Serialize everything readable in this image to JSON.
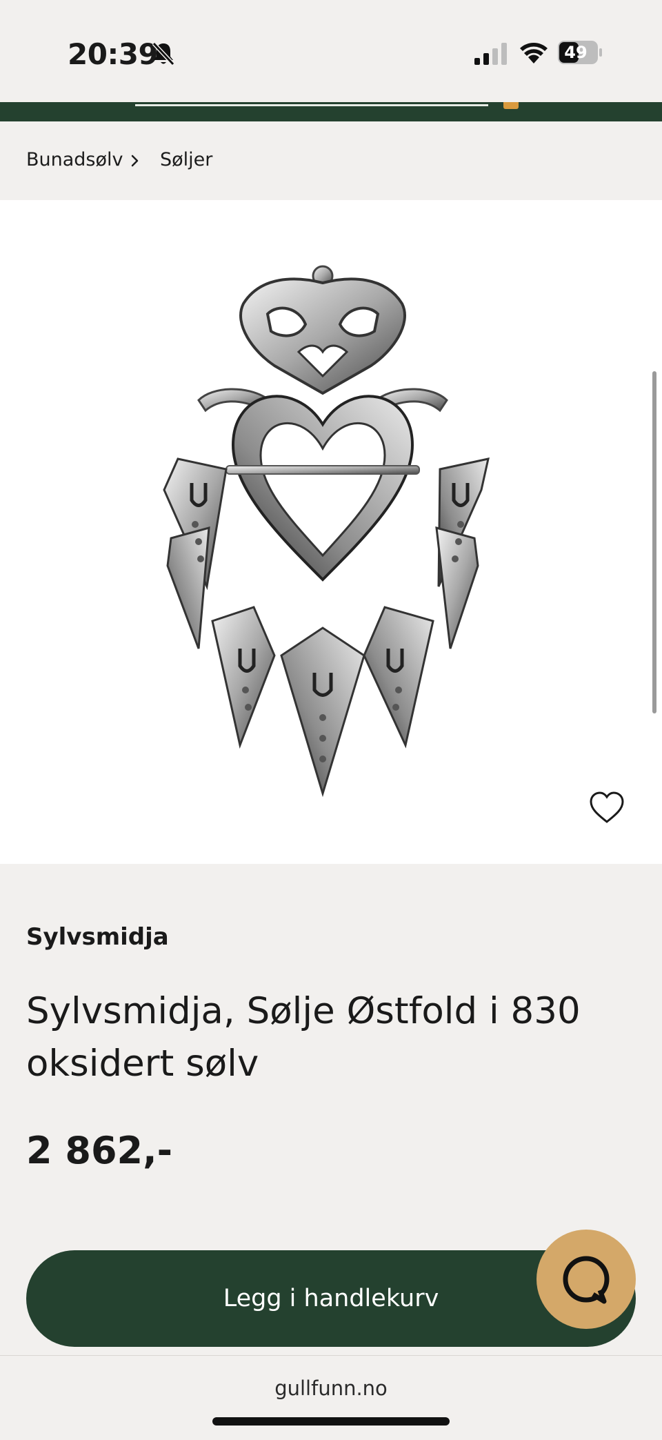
{
  "status_bar": {
    "time": "20:39",
    "battery": "49",
    "icons": [
      "bell-muted-icon",
      "signal-icon",
      "wifi-icon",
      "battery-icon"
    ]
  },
  "breadcrumb": {
    "items": [
      "Bunadsølv",
      "Søljer"
    ]
  },
  "product": {
    "brand": "Sylvsmidja",
    "title": "Sylvsmidja, Sølje Østfold i 830 oksidert sølv",
    "price": "2 862,-",
    "add_to_cart_label": "Legg i handlekurv"
  },
  "browser": {
    "url": "gullfunn.no"
  },
  "colors": {
    "brand_green": "#24412f",
    "chat_gold": "#d4a869",
    "background": "#f2f0ee"
  }
}
